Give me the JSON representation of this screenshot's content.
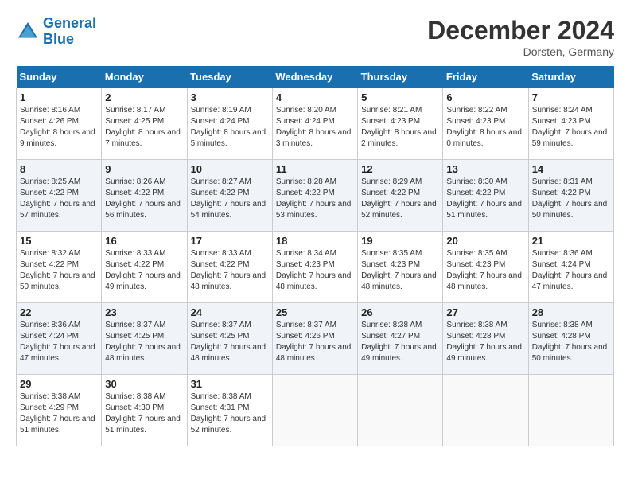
{
  "header": {
    "logo_line1": "General",
    "logo_line2": "Blue",
    "month": "December 2024",
    "location": "Dorsten, Germany"
  },
  "days_of_week": [
    "Sunday",
    "Monday",
    "Tuesday",
    "Wednesday",
    "Thursday",
    "Friday",
    "Saturday"
  ],
  "weeks": [
    [
      {
        "day": "1",
        "sunrise": "8:16 AM",
        "sunset": "4:26 PM",
        "daylight": "8 hours and 9 minutes."
      },
      {
        "day": "2",
        "sunrise": "8:17 AM",
        "sunset": "4:25 PM",
        "daylight": "8 hours and 7 minutes."
      },
      {
        "day": "3",
        "sunrise": "8:19 AM",
        "sunset": "4:24 PM",
        "daylight": "8 hours and 5 minutes."
      },
      {
        "day": "4",
        "sunrise": "8:20 AM",
        "sunset": "4:24 PM",
        "daylight": "8 hours and 3 minutes."
      },
      {
        "day": "5",
        "sunrise": "8:21 AM",
        "sunset": "4:23 PM",
        "daylight": "8 hours and 2 minutes."
      },
      {
        "day": "6",
        "sunrise": "8:22 AM",
        "sunset": "4:23 PM",
        "daylight": "8 hours and 0 minutes."
      },
      {
        "day": "7",
        "sunrise": "8:24 AM",
        "sunset": "4:23 PM",
        "daylight": "7 hours and 59 minutes."
      }
    ],
    [
      {
        "day": "8",
        "sunrise": "8:25 AM",
        "sunset": "4:22 PM",
        "daylight": "7 hours and 57 minutes."
      },
      {
        "day": "9",
        "sunrise": "8:26 AM",
        "sunset": "4:22 PM",
        "daylight": "7 hours and 56 minutes."
      },
      {
        "day": "10",
        "sunrise": "8:27 AM",
        "sunset": "4:22 PM",
        "daylight": "7 hours and 54 minutes."
      },
      {
        "day": "11",
        "sunrise": "8:28 AM",
        "sunset": "4:22 PM",
        "daylight": "7 hours and 53 minutes."
      },
      {
        "day": "12",
        "sunrise": "8:29 AM",
        "sunset": "4:22 PM",
        "daylight": "7 hours and 52 minutes."
      },
      {
        "day": "13",
        "sunrise": "8:30 AM",
        "sunset": "4:22 PM",
        "daylight": "7 hours and 51 minutes."
      },
      {
        "day": "14",
        "sunrise": "8:31 AM",
        "sunset": "4:22 PM",
        "daylight": "7 hours and 50 minutes."
      }
    ],
    [
      {
        "day": "15",
        "sunrise": "8:32 AM",
        "sunset": "4:22 PM",
        "daylight": "7 hours and 50 minutes."
      },
      {
        "day": "16",
        "sunrise": "8:33 AM",
        "sunset": "4:22 PM",
        "daylight": "7 hours and 49 minutes."
      },
      {
        "day": "17",
        "sunrise": "8:33 AM",
        "sunset": "4:22 PM",
        "daylight": "7 hours and 48 minutes."
      },
      {
        "day": "18",
        "sunrise": "8:34 AM",
        "sunset": "4:23 PM",
        "daylight": "7 hours and 48 minutes."
      },
      {
        "day": "19",
        "sunrise": "8:35 AM",
        "sunset": "4:23 PM",
        "daylight": "7 hours and 48 minutes."
      },
      {
        "day": "20",
        "sunrise": "8:35 AM",
        "sunset": "4:23 PM",
        "daylight": "7 hours and 48 minutes."
      },
      {
        "day": "21",
        "sunrise": "8:36 AM",
        "sunset": "4:24 PM",
        "daylight": "7 hours and 47 minutes."
      }
    ],
    [
      {
        "day": "22",
        "sunrise": "8:36 AM",
        "sunset": "4:24 PM",
        "daylight": "7 hours and 47 minutes."
      },
      {
        "day": "23",
        "sunrise": "8:37 AM",
        "sunset": "4:25 PM",
        "daylight": "7 hours and 48 minutes."
      },
      {
        "day": "24",
        "sunrise": "8:37 AM",
        "sunset": "4:25 PM",
        "daylight": "7 hours and 48 minutes."
      },
      {
        "day": "25",
        "sunrise": "8:37 AM",
        "sunset": "4:26 PM",
        "daylight": "7 hours and 48 minutes."
      },
      {
        "day": "26",
        "sunrise": "8:38 AM",
        "sunset": "4:27 PM",
        "daylight": "7 hours and 49 minutes."
      },
      {
        "day": "27",
        "sunrise": "8:38 AM",
        "sunset": "4:28 PM",
        "daylight": "7 hours and 49 minutes."
      },
      {
        "day": "28",
        "sunrise": "8:38 AM",
        "sunset": "4:28 PM",
        "daylight": "7 hours and 50 minutes."
      }
    ],
    [
      {
        "day": "29",
        "sunrise": "8:38 AM",
        "sunset": "4:29 PM",
        "daylight": "7 hours and 51 minutes."
      },
      {
        "day": "30",
        "sunrise": "8:38 AM",
        "sunset": "4:30 PM",
        "daylight": "7 hours and 51 minutes."
      },
      {
        "day": "31",
        "sunrise": "8:38 AM",
        "sunset": "4:31 PM",
        "daylight": "7 hours and 52 minutes."
      },
      null,
      null,
      null,
      null
    ]
  ]
}
